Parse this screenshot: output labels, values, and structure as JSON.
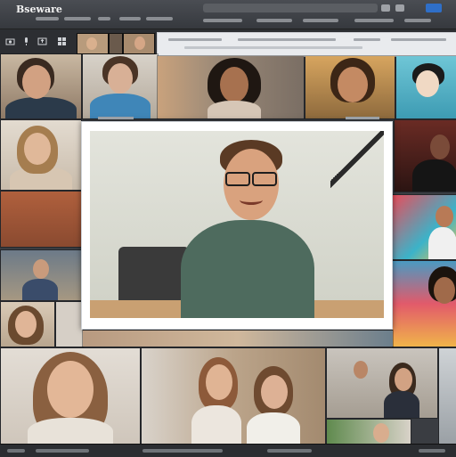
{
  "app": {
    "title": "Bseware"
  },
  "colors": {
    "accent": "#2f6fc8",
    "window": "#3a3d42",
    "toolbar": "#2c2e32"
  },
  "toolbar": {
    "icons": [
      "camera-icon",
      "mic-icon",
      "share-icon",
      "grid-icon"
    ]
  }
}
